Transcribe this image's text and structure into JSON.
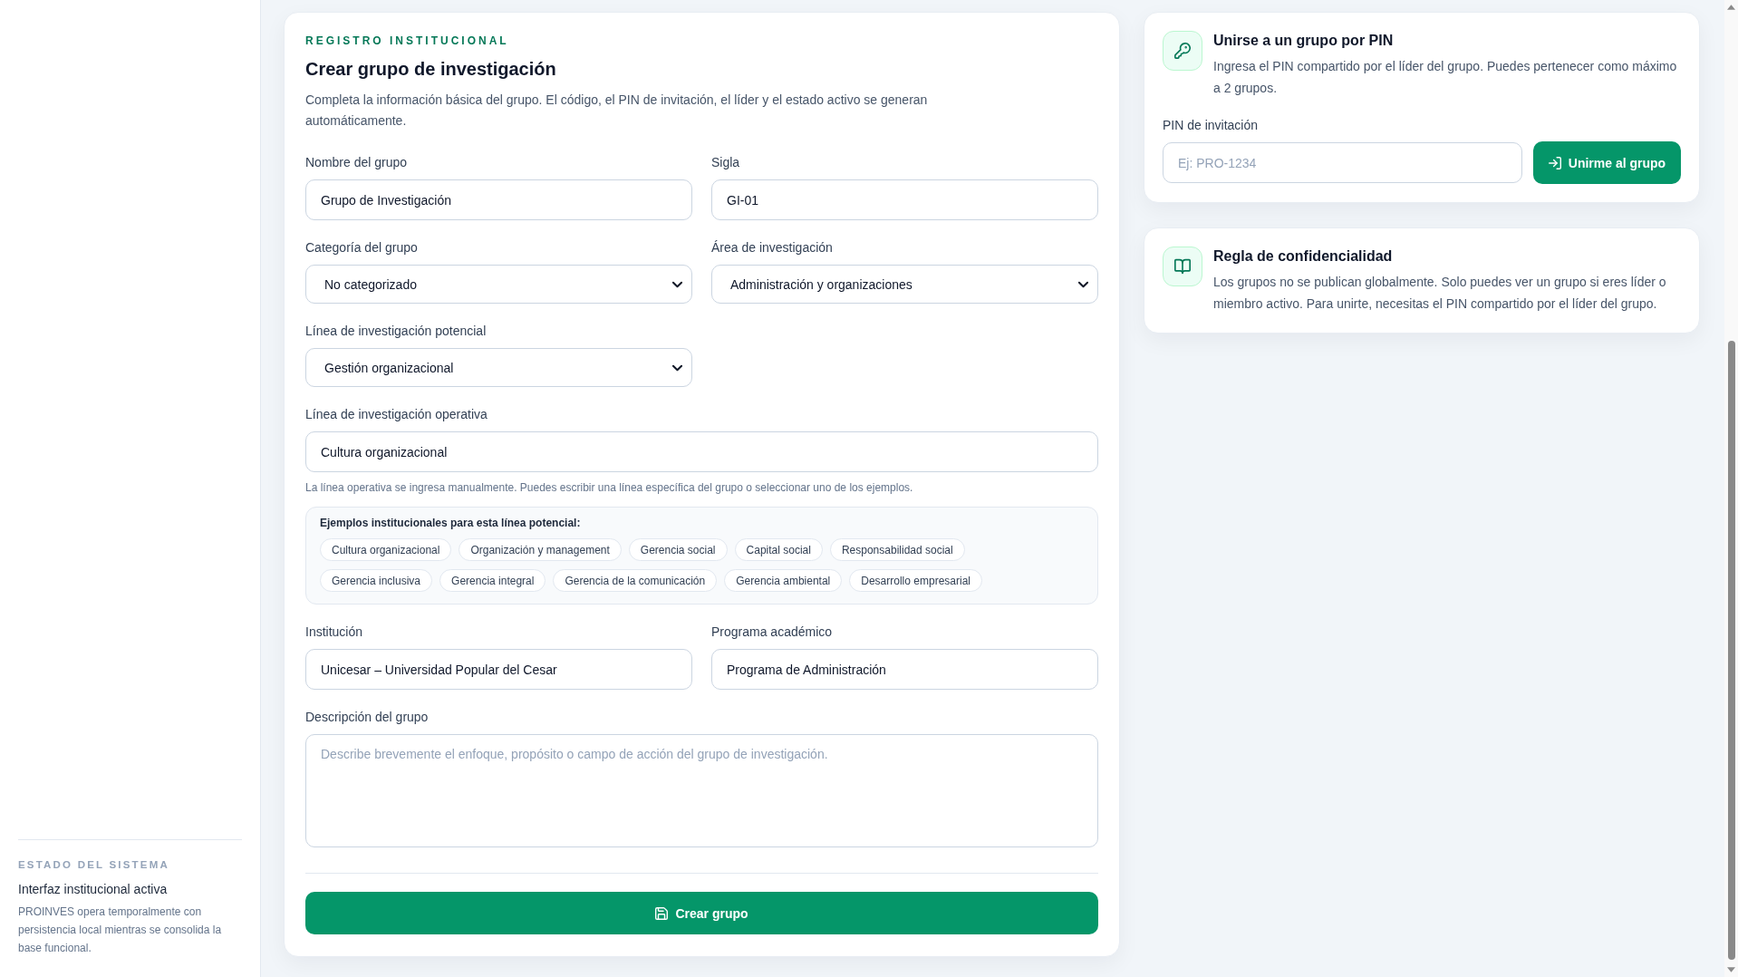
{
  "sidebar": {
    "status": {
      "heading": "ESTADO DEL SISTEMA",
      "title": "Interfaz institucional activa",
      "text": "PROINVES opera temporalmente con persistencia local mientras se consolida la base funcional."
    }
  },
  "form": {
    "eyebrow": "REGISTRO INSTITUCIONAL",
    "title": "Crear grupo de investigación",
    "intro": "Completa la información básica del grupo. El código, el PIN de invitación, el líder y el estado activo se generan automáticamente.",
    "sections": [
      {
        "kind": "grid",
        "fields": [
          {
            "kind": "input",
            "label": "Nombre del grupo",
            "value": "Grupo de Investigación"
          },
          {
            "kind": "input",
            "label": "Sigla",
            "value": "GI-01"
          },
          {
            "kind": "select",
            "label": "Categoría del grupo",
            "value": "No categorizado"
          },
          {
            "kind": "select",
            "label": "Área de investigación",
            "value": "Administración y organizaciones"
          },
          {
            "kind": "select",
            "label": "Línea de investigación potencial",
            "value": "Gestión organizacional"
          }
        ]
      },
      {
        "kind": "wide",
        "label": "Línea de investigación operativa",
        "value": "Cultura organizacional",
        "help": "La línea operativa se ingresa manualmente. Puedes escribir una línea específica del grupo o seleccionar uno de los ejemplos.",
        "examples": {
          "heading": "Ejemplos institucionales para esta línea potencial:",
          "chips": [
            "Cultura organizacional",
            "Organización y management",
            "Gerencia social",
            "Capital social",
            "Responsabilidad social",
            "Gerencia inclusiva",
            "Gerencia integral",
            "Gerencia de la comunicación",
            "Gerencia ambiental",
            "Desarrollo empresarial"
          ]
        }
      },
      {
        "kind": "grid",
        "fields": [
          {
            "kind": "input",
            "label": "Institución",
            "value": "Unicesar – Universidad Popular del Cesar"
          },
          {
            "kind": "input",
            "label": "Programa académico",
            "value": "Programa de Administración"
          }
        ]
      },
      {
        "kind": "textarea",
        "label": "Descripción del grupo",
        "placeholder": "Describe brevemente el enfoque, propósito o campo de acción del grupo de investigación."
      }
    ],
    "submit": {
      "label": "Crear grupo"
    }
  },
  "join_card": {
    "title": "Unirse a un grupo por PIN",
    "text": "Ingresa el PIN compartido por el líder del grupo. Puedes pertenecer como máximo a 2 grupos.",
    "pin_field": {
      "label": "PIN de invitación",
      "placeholder": "Ej: PRO-1234"
    },
    "button": {
      "label": "Unirme al grupo"
    }
  },
  "rule_card": {
    "title": "Regla de confidencialidad",
    "text": "Los grupos no se publican globalmente. Solo puedes ver un grupo si eres líder o miembro activo. Para unirte, necesitas el PIN compartido por el líder del grupo."
  }
}
